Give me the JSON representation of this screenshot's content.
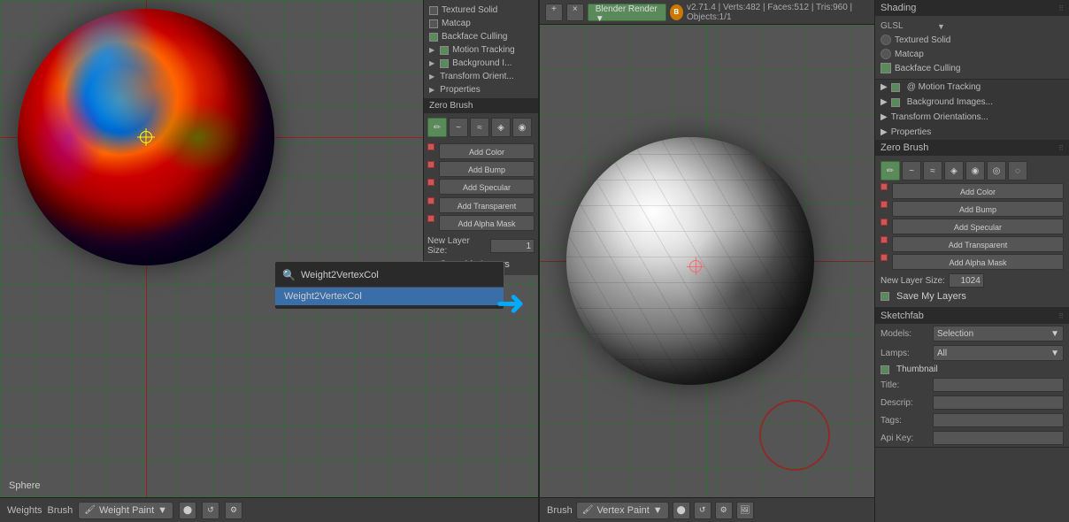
{
  "app": {
    "title": "Blender",
    "version": "v2.71.4",
    "stats": "Verts:482 | Faces:512 | Tris:960 | Objects:1/1"
  },
  "left_panel": {
    "sphere_label": "Sphere",
    "bottom_bar": {
      "weights_label": "Weights",
      "brush_label": "Brush",
      "mode_label": "Weight Paint"
    }
  },
  "overlay_menu": {
    "items": [
      {
        "label": "Textured Solid",
        "checked": false,
        "type": "checkbox"
      },
      {
        "label": "Matcap",
        "checked": false,
        "type": "checkbox"
      },
      {
        "label": "Backface Culling",
        "checked": true,
        "type": "checkbox"
      },
      {
        "label": "Motion Tracking",
        "checked": true,
        "type": "section"
      },
      {
        "label": "Background I...",
        "checked": true,
        "type": "section"
      },
      {
        "label": "Transform Orients...",
        "type": "section"
      },
      {
        "label": "Properties",
        "type": "section"
      }
    ],
    "zero_brush": "Zero Brush",
    "add_buttons": [
      "Add Color",
      "Add Bump",
      "Add Specular",
      "Add Transparent",
      "Add Alpha Mask"
    ],
    "new_layer": "New Layer Size: 1",
    "save_layers": "Save My Layers"
  },
  "dropdown": {
    "title": "Weight2VertexCol",
    "items": [
      {
        "label": "Weight2VertexCol"
      }
    ]
  },
  "right_panel": {
    "top_bar": {
      "plus_btn": "+",
      "close_btn": "×",
      "render_engine": "Blender Render",
      "toggle_quad": "Toggle Quad View"
    },
    "bottom_bar": {
      "brush_label": "Brush",
      "mode_label": "Vertex Paint"
    }
  },
  "right_sidebar": {
    "shading_section": "Shading",
    "shading_items": [
      {
        "label": "GLSL",
        "type": "header"
      },
      {
        "label": "Textured Solid",
        "checked": false
      },
      {
        "label": "Matcap",
        "checked": false
      },
      {
        "label": "Backface Culling",
        "checked": true
      }
    ],
    "motion_tracking": "@ Motion Tracking",
    "background_images": "Background Images...",
    "transform_orientations": "Transform Orientations...",
    "properties": "Properties",
    "zero_brush": "Zero Brush",
    "tool_buttons": [
      "draw",
      "soften",
      "smear",
      "clone",
      "blur",
      "average",
      "smudge"
    ],
    "add_buttons": [
      "Add Color",
      "Add Bump",
      "Add Specular",
      "Add Transparent",
      "Add Alpha Mask"
    ],
    "new_layer_size": "New Layer Size: 1024",
    "save_my_layers": "Save My Layers",
    "sketchfab_section": "Sketchfab",
    "sketchfab_fields": {
      "models_label": "Models:",
      "models_value": "Selection",
      "lamps_label": "Lamps:",
      "lamps_value": "All",
      "thumbnail_label": "Thumbnail",
      "title_label": "Title:",
      "description_label": "Descrip:",
      "tags_label": "Tags:",
      "api_key_label": "Api Key:"
    }
  }
}
